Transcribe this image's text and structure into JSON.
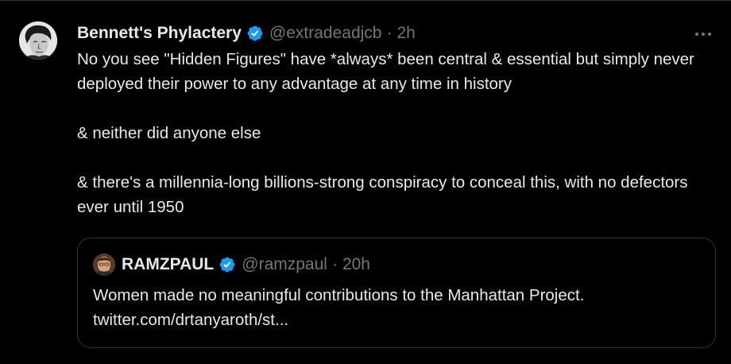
{
  "tweet": {
    "author_name": "Bennett's Phylactery",
    "handle": "@extradeadjcb",
    "separator": "·",
    "time": "2h",
    "more_label": "•••",
    "paragraphs": [
      "No you see \"Hidden Figures\" have *always* been central & essential but simply never deployed their power to any advantage at any time in history",
      "& neither did anyone else",
      "& there's a millennia-long billions-strong conspiracy to conceal this, with no defectors ever until 1950"
    ]
  },
  "quoted": {
    "author_name": "RAMZPAUL",
    "handle": "@ramzpaul",
    "separator": "·",
    "time": "20h",
    "line1": "Women made no meaningful contributions to the Manhattan Project.",
    "line2": "twitter.com/drtanyaroth/st..."
  },
  "colors": {
    "background": "#000000",
    "text": "#e7e9ea",
    "muted": "#71767b",
    "border": "#2f3336",
    "verified": "#1d9bf0"
  },
  "icons": {
    "verified": "verified-badge-icon",
    "more": "more-dots-icon"
  }
}
